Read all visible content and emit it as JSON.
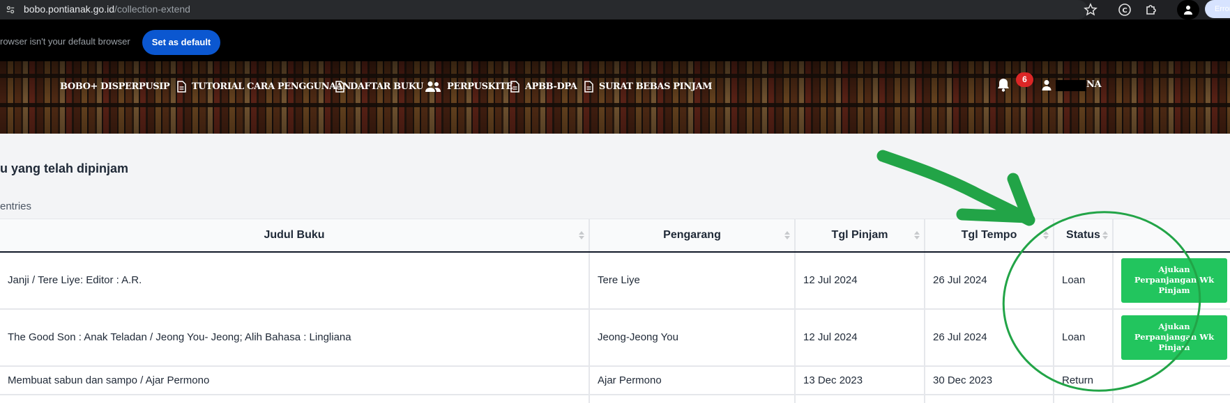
{
  "browser": {
    "url_host": "bobo.pontianak.go.id",
    "url_path": "/collection-extend",
    "error_label": "Error",
    "infobar_text": "rowser isn't your default browser",
    "set_default_label": "Set as default"
  },
  "nav": {
    "brand": "BOBO+ DISPERPUSIP",
    "items": [
      {
        "label": "TUTORIAL CARA PENGGUNAAN",
        "icon": "document-icon"
      },
      {
        "label": "DAFTAR BUKU",
        "icon": "document-icon"
      },
      {
        "label": "PERPUSKITE",
        "icon": "users-icon"
      },
      {
        "label": "APBB-DPA",
        "icon": "document-icon"
      },
      {
        "label": "SURAT BEBAS PINJAM",
        "icon": "document-icon"
      }
    ],
    "notification_count": "6",
    "user_name_suffix": "NA"
  },
  "page": {
    "title": "u yang telah dipinjam",
    "entries_label": "entries"
  },
  "table": {
    "headers": [
      "Judul Buku",
      "Pengarang",
      "Tgl Pinjam",
      "Tgl Tempo",
      "Status",
      ""
    ],
    "rows": [
      {
        "judul": "Janji / Tere Liye: Editor : A.R.",
        "pengarang": "Tere Liye",
        "tgl_pinjam": "12 Jul 2024",
        "tgl_tempo": "26 Jul 2024",
        "status": "Loan",
        "action": "Ajukan Perpanjangan Wk Pinjam"
      },
      {
        "judul": "The Good Son : Anak Teladan / Jeong You- Jeong; Alih Bahasa : Lingliana",
        "pengarang": "Jeong-Jeong You",
        "tgl_pinjam": "12 Jul 2024",
        "tgl_tempo": "26 Jul 2024",
        "status": "Loan",
        "action": "Ajukan Perpanjangan Wk Pinjam"
      },
      {
        "judul": "Membuat sabun dan sampo / Ajar Permono",
        "pengarang": "Ajar Permono",
        "tgl_pinjam": "13 Dec 2023",
        "tgl_tempo": "30 Dec 2023",
        "status": "Return",
        "action": ""
      }
    ]
  },
  "colors": {
    "accent_green": "#22c55e",
    "annotation_green": "#22a447",
    "badge_red": "#dc2626",
    "browser_blue": "#0b57d0"
  }
}
